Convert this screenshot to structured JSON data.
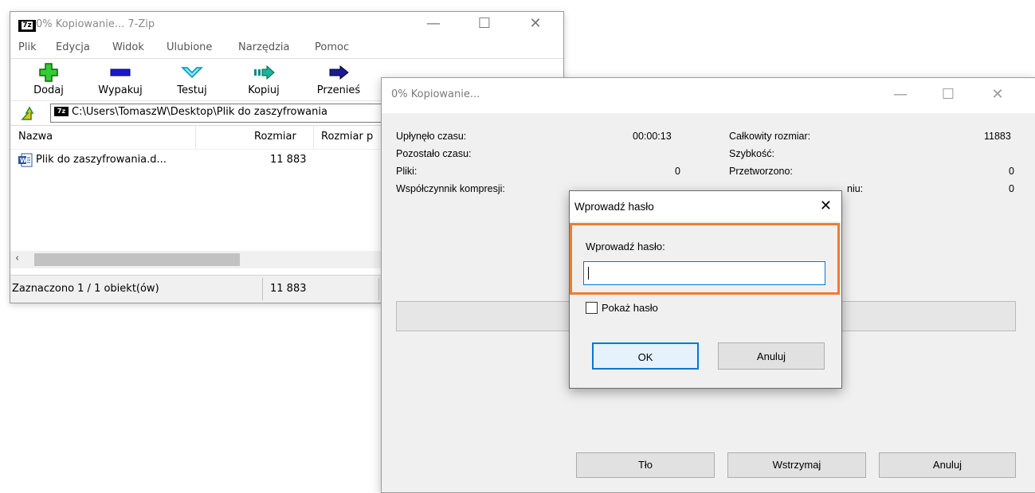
{
  "main_window": {
    "title": "0% Kopiowanie... 7-Zip",
    "app_icon_text": "7z",
    "menu": [
      "Plik",
      "Edycja",
      "Widok",
      "Ulubione",
      "Narzędzia",
      "Pomoc"
    ],
    "toolbar": [
      {
        "label": "Dodaj",
        "icon": "plus-icon",
        "color": "#22aa22"
      },
      {
        "label": "Wypakuj",
        "icon": "minus-icon",
        "color": "#0000cc"
      },
      {
        "label": "Testuj",
        "icon": "check-icon",
        "color": "#00a0c8"
      },
      {
        "label": "Kopiuj",
        "icon": "copy-arrow-icon",
        "color": "#0a8a8a"
      },
      {
        "label": "Przenieś",
        "icon": "move-arrow-icon",
        "color": "#000080"
      }
    ],
    "address": "C:\\Users\\TomaszW\\Desktop\\Plik do zaszyfrowania",
    "columns": [
      "Nazwa",
      "Rozmiar",
      "Rozmiar p"
    ],
    "files": [
      {
        "name": "Plik do zaszyfrowania.d...",
        "size": "11 883"
      }
    ],
    "status": {
      "selected": "Zaznaczono 1 / 1 obiekt(ów)",
      "size": "11 883"
    }
  },
  "progress_window": {
    "title": "0% Kopiowanie...",
    "left_labels": {
      "elapsed": "Upłynęło czasu:",
      "remaining": "Pozostało czasu:",
      "files": "Pliki:",
      "ratio": "Współczynnik kompresji:"
    },
    "left_values": {
      "elapsed": "00:00:13",
      "files": "0"
    },
    "right_labels": {
      "total": "Całkowity rozmiar:",
      "speed": "Szybkość:",
      "processed": "Przetworzono:",
      "partial": "niu:"
    },
    "right_values": {
      "total": "11883",
      "processed": "0",
      "partial": "0"
    },
    "progress": 0,
    "buttons": {
      "background": "Tło",
      "pause": "Wstrzymaj",
      "cancel": "Anuluj"
    }
  },
  "password_dialog": {
    "title": "Wprowadź hasło",
    "label": "Wprowadź hasło:",
    "value": "",
    "show_password": "Pokaż hasło",
    "ok": "OK",
    "cancel": "Anuluj",
    "highlight_color": "#ed7d31"
  }
}
